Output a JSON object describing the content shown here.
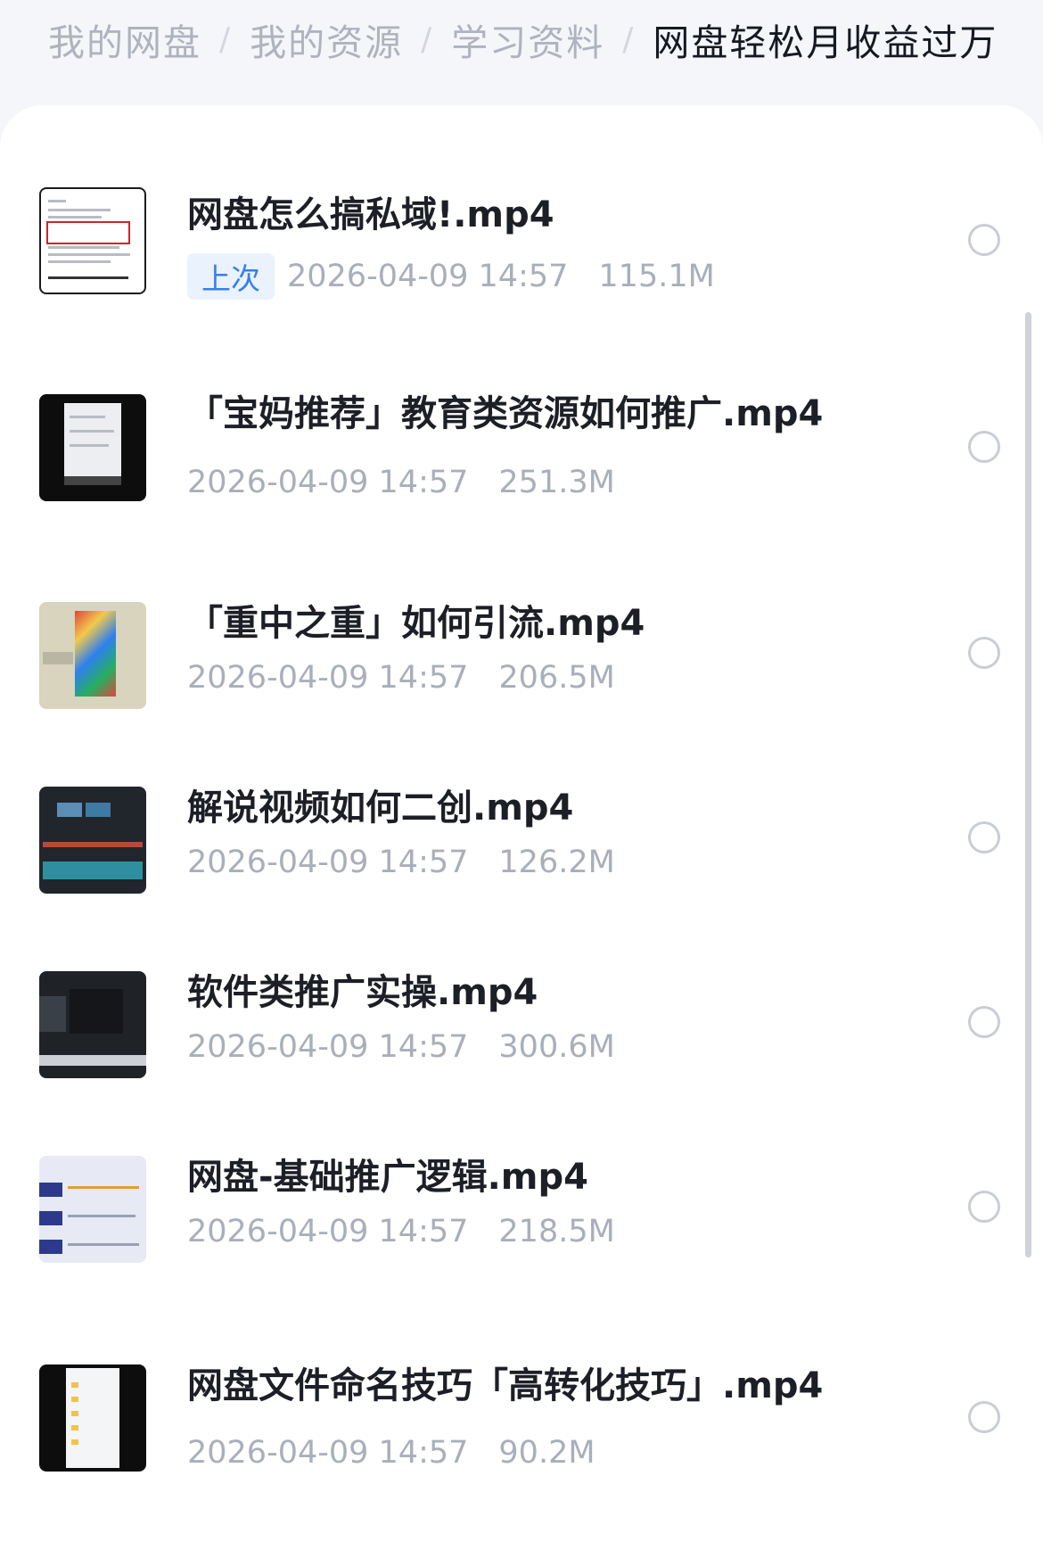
{
  "breadcrumb": {
    "items": [
      "我的网盘",
      "我的资源",
      "学习资料"
    ],
    "current": "网盘轻松月收益过万",
    "separator": "/"
  },
  "files": [
    {
      "name": "网盘怎么搞私域!.mp4",
      "tag": "上次",
      "date": "2026-04-09 14:57",
      "size": "115.1M",
      "thumb": "white-doc"
    },
    {
      "name": "「宝妈推荐」教育类资源如何推广.mp4",
      "tag": "",
      "date": "2026-04-09 14:57",
      "size": "251.3M",
      "thumb": "black-phone"
    },
    {
      "name": "「重中之重」如何引流.mp4",
      "tag": "",
      "date": "2026-04-09 14:57",
      "size": "206.5M",
      "thumb": "beige-lego"
    },
    {
      "name": "解说视频如何二创.mp4",
      "tag": "",
      "date": "2026-04-09 14:57",
      "size": "126.2M",
      "thumb": "dark-editor"
    },
    {
      "name": "软件类推广实操.mp4",
      "tag": "",
      "date": "2026-04-09 14:57",
      "size": "300.6M",
      "thumb": "dark-editor-2"
    },
    {
      "name": "网盘-基础推广逻辑.mp4",
      "tag": "",
      "date": "2026-04-09 14:57",
      "size": "218.5M",
      "thumb": "light-slide"
    },
    {
      "name": "网盘文件命名技巧「高转化技巧」.mp4",
      "tag": "",
      "date": "2026-04-09 14:57",
      "size": "90.2M",
      "thumb": "black-phone-list"
    }
  ],
  "colors": {
    "tag_bg": "#eaf2fe",
    "tag_text": "#3a7fe8",
    "meta_text": "#a9afba",
    "name_text": "#1c1f26"
  }
}
